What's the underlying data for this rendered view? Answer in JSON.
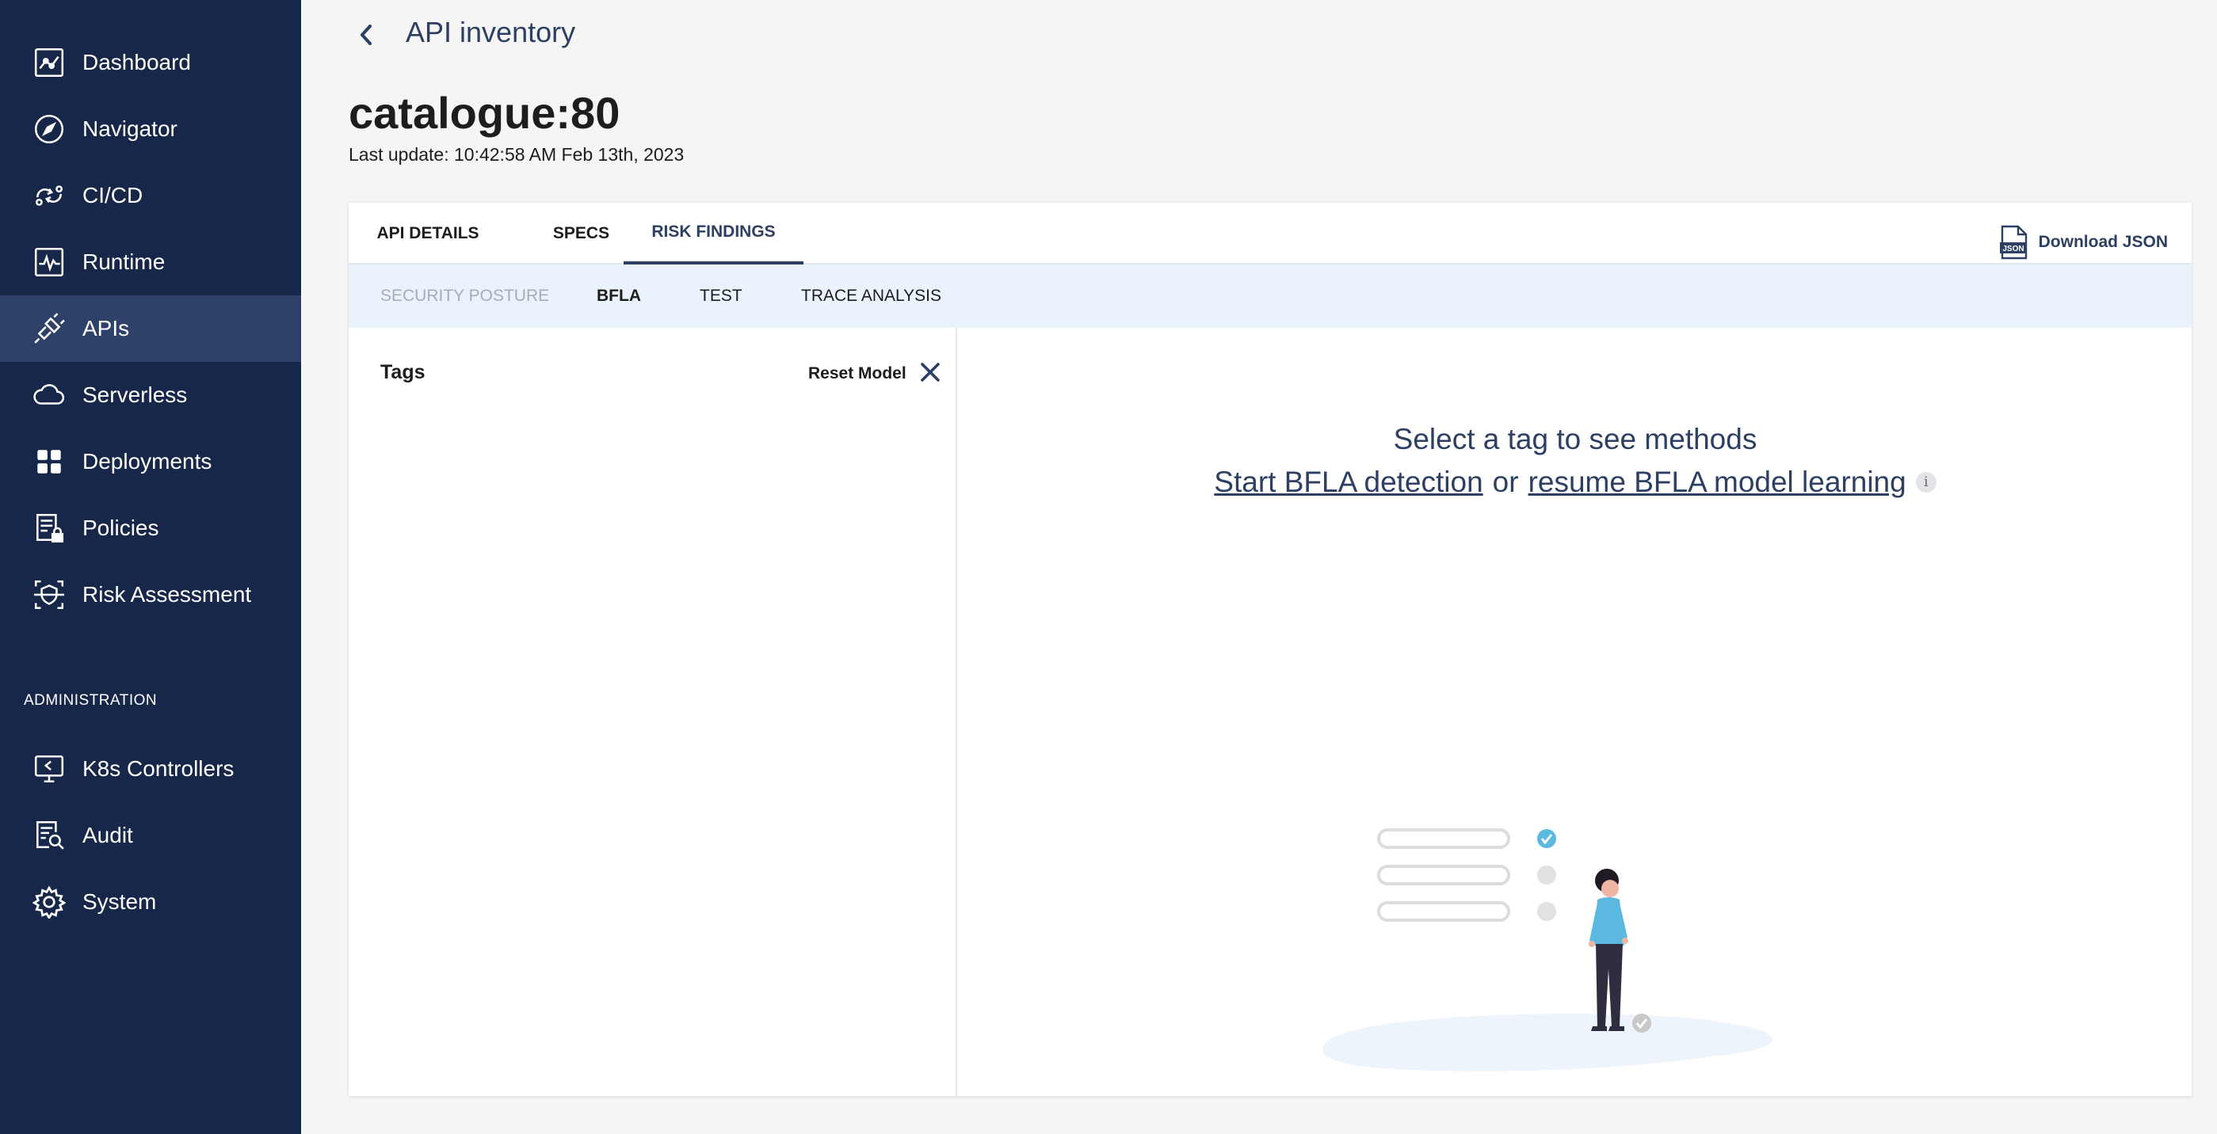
{
  "sidebar": {
    "items": [
      {
        "label": "Dashboard",
        "icon": "dashboard-icon"
      },
      {
        "label": "Navigator",
        "icon": "compass-icon"
      },
      {
        "label": "CI/CD",
        "icon": "cicd-icon"
      },
      {
        "label": "Runtime",
        "icon": "runtime-icon"
      },
      {
        "label": "APIs",
        "icon": "api-plug-icon",
        "active": true
      },
      {
        "label": "Serverless",
        "icon": "cloud-icon"
      },
      {
        "label": "Deployments",
        "icon": "grid-icon"
      },
      {
        "label": "Policies",
        "icon": "policy-lock-icon"
      },
      {
        "label": "Risk Assessment",
        "icon": "shield-scan-icon"
      }
    ],
    "section_label": "ADMINISTRATION",
    "admin_items": [
      {
        "label": "K8s Controllers",
        "icon": "monitor-icon"
      },
      {
        "label": "Audit",
        "icon": "audit-search-icon"
      },
      {
        "label": "System",
        "icon": "gear-icon"
      }
    ]
  },
  "header": {
    "breadcrumb": "API inventory",
    "title": "catalogue:80",
    "last_update": "Last update: 10:42:58 AM Feb 13th, 2023"
  },
  "tabs": [
    {
      "label": "API DETAILS"
    },
    {
      "label": "SPECS"
    },
    {
      "label": "RISK FINDINGS",
      "active": true
    }
  ],
  "download_label": "Download JSON",
  "json_icon_text": "JSON",
  "subtabs": [
    {
      "label": "SECURITY POSTURE",
      "disabled": true
    },
    {
      "label": "BFLA",
      "active": true
    },
    {
      "label": "TEST"
    },
    {
      "label": "TRACE ANALYSIS"
    }
  ],
  "tags_panel": {
    "title": "Tags",
    "reset_label": "Reset Model"
  },
  "empty_state": {
    "title": "Select a tag to see methods",
    "start_link": "Start BFLA detection",
    "or_text": "or",
    "resume_link": "resume BFLA model learning",
    "info_glyph": "i"
  },
  "colors": {
    "sidebar_bg": "#17274a",
    "sidebar_active": "#2e4269",
    "accent": "#2d3f63",
    "subtab_bg": "#eaf2fb",
    "illustration_blue": "#5bb8e0"
  }
}
